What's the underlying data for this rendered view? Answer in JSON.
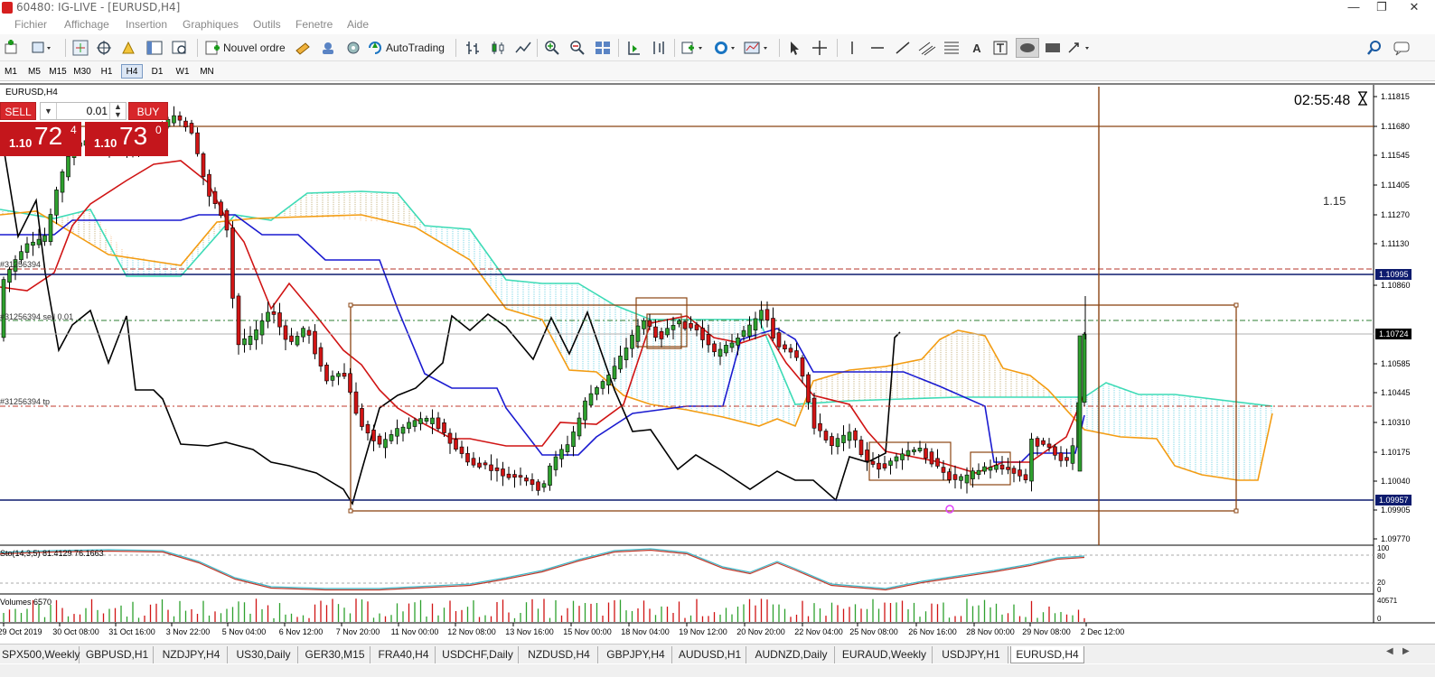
{
  "window": {
    "title": "60480: IG-LIVE - [EURUSD,H4]"
  },
  "menu": [
    "Fichier",
    "Affichage",
    "Insertion",
    "Graphiques",
    "Outils",
    "Fenetre",
    "Aide"
  ],
  "toolbar": {
    "new_order": "Nouvel ordre",
    "autotrading": "AutoTrading"
  },
  "timeframes": [
    "M1",
    "M5",
    "M15",
    "M30",
    "H1",
    "H4",
    "D1",
    "W1",
    "MN"
  ],
  "chart": {
    "symbol_label": "EURUSD,H4",
    "countdown": "02:55:48",
    "annotation": "1.15",
    "price_labels": [
      "1.11815",
      "1.11680",
      "1.11545",
      "1.11405",
      "1.11270",
      "1.11130",
      "1.10860",
      "1.10585",
      "1.10445",
      "1.10310",
      "1.10175",
      "1.10040",
      "1.09905",
      "1.09770"
    ],
    "price_tags": {
      "blue_line": "1.10995",
      "current": "1.10724",
      "support": "1.09957"
    },
    "order_labels": {
      "order": "#31256394",
      "sell": "#31256394 sell 0.01",
      "tp": "#31256394 tp"
    },
    "time_labels": [
      "29 Oct 2019",
      "30 Oct 08:00",
      "31 Oct 16:00",
      "3 Nov 22:00",
      "5 Nov 04:00",
      "6 Nov 12:00",
      "7 Nov 20:00",
      "11 Nov 00:00",
      "12 Nov 08:00",
      "13 Nov 16:00",
      "15 Nov 00:00",
      "18 Nov 04:00",
      "19 Nov 12:00",
      "20 Nov 20:00",
      "22 Nov 04:00",
      "25 Nov 08:00",
      "26 Nov 16:00",
      "28 Nov 00:00",
      "29 Nov 08:00",
      "2 Dec 12:00"
    ]
  },
  "trade_panel": {
    "sell_label": "SELL",
    "buy_label": "BUY",
    "lot": "0.01",
    "sell_price": {
      "prefix": "1.10",
      "big": "72",
      "sup": "4"
    },
    "buy_price": {
      "prefix": "1.10",
      "big": "73",
      "sup": "0"
    }
  },
  "stochastic": {
    "label": "Sto(14,3,5) 81.4129 76.1663",
    "scale": [
      "100",
      "80",
      "20",
      "0"
    ]
  },
  "volumes": {
    "label": "Volumes 6570",
    "scale": [
      "40571",
      "0"
    ]
  },
  "tabs": [
    "SPX500,Weekly",
    "GBPUSD,H1",
    "NZDJPY,H4",
    "US30,Daily",
    "GER30,M15",
    "FRA40,H4",
    "USDCHF,Daily",
    "NZDUSD,H4",
    "GBPJPY,H4",
    "AUDUSD,H1",
    "AUDNZD,Daily",
    "EURAUD,Weekly",
    "USDJPY,H1",
    "EURUSD,H4"
  ],
  "active_tab": "EURUSD,H4"
}
